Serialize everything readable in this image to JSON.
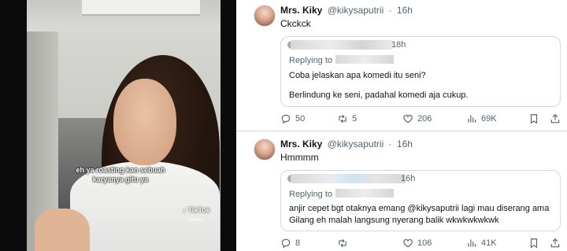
{
  "video": {
    "caption_line1": "eh ya roasting kan sebuah",
    "caption_line2": "karyanya gitu ya",
    "tiktok_label": "TikTok",
    "tiktok_handle": "@ylkko"
  },
  "tweets": [
    {
      "display_name": "Mrs. Kiky",
      "handle": "@kikysaputrii",
      "separator": "·",
      "time": "16h",
      "text": "Ckckck",
      "quote": {
        "time": "18h",
        "replying_to": "Replying to",
        "body": [
          "Coba jelaskan apa komedi itu seni?",
          "Berlindung ke seni, padahal komedi aja cukup."
        ]
      },
      "stats": {
        "replies": "50",
        "retweets": "5",
        "likes": "206",
        "views": "69K"
      }
    },
    {
      "display_name": "Mrs. Kiky",
      "handle": "@kikysaputrii",
      "separator": "·",
      "time": "16h",
      "text": "Hmmmm",
      "quote": {
        "time": "16h",
        "replying_to": "Replying to",
        "body": [
          "anjir cepet bgt otaknya emang @kikysaputrii lagi mau diserang ama",
          "Gilang eh malah langsung nyerang balik wkwkwkwkwk"
        ]
      },
      "stats": {
        "replies": "8",
        "retweets": "",
        "likes": "106",
        "views": "41K"
      }
    }
  ],
  "colors": {
    "text_primary": "#0f1419",
    "text_secondary": "#536471",
    "border": "#cfd9de"
  },
  "icons": [
    "reply-icon",
    "retweet-icon",
    "like-icon",
    "views-icon",
    "bookmark-icon",
    "share-icon",
    "tiktok-icon"
  ]
}
